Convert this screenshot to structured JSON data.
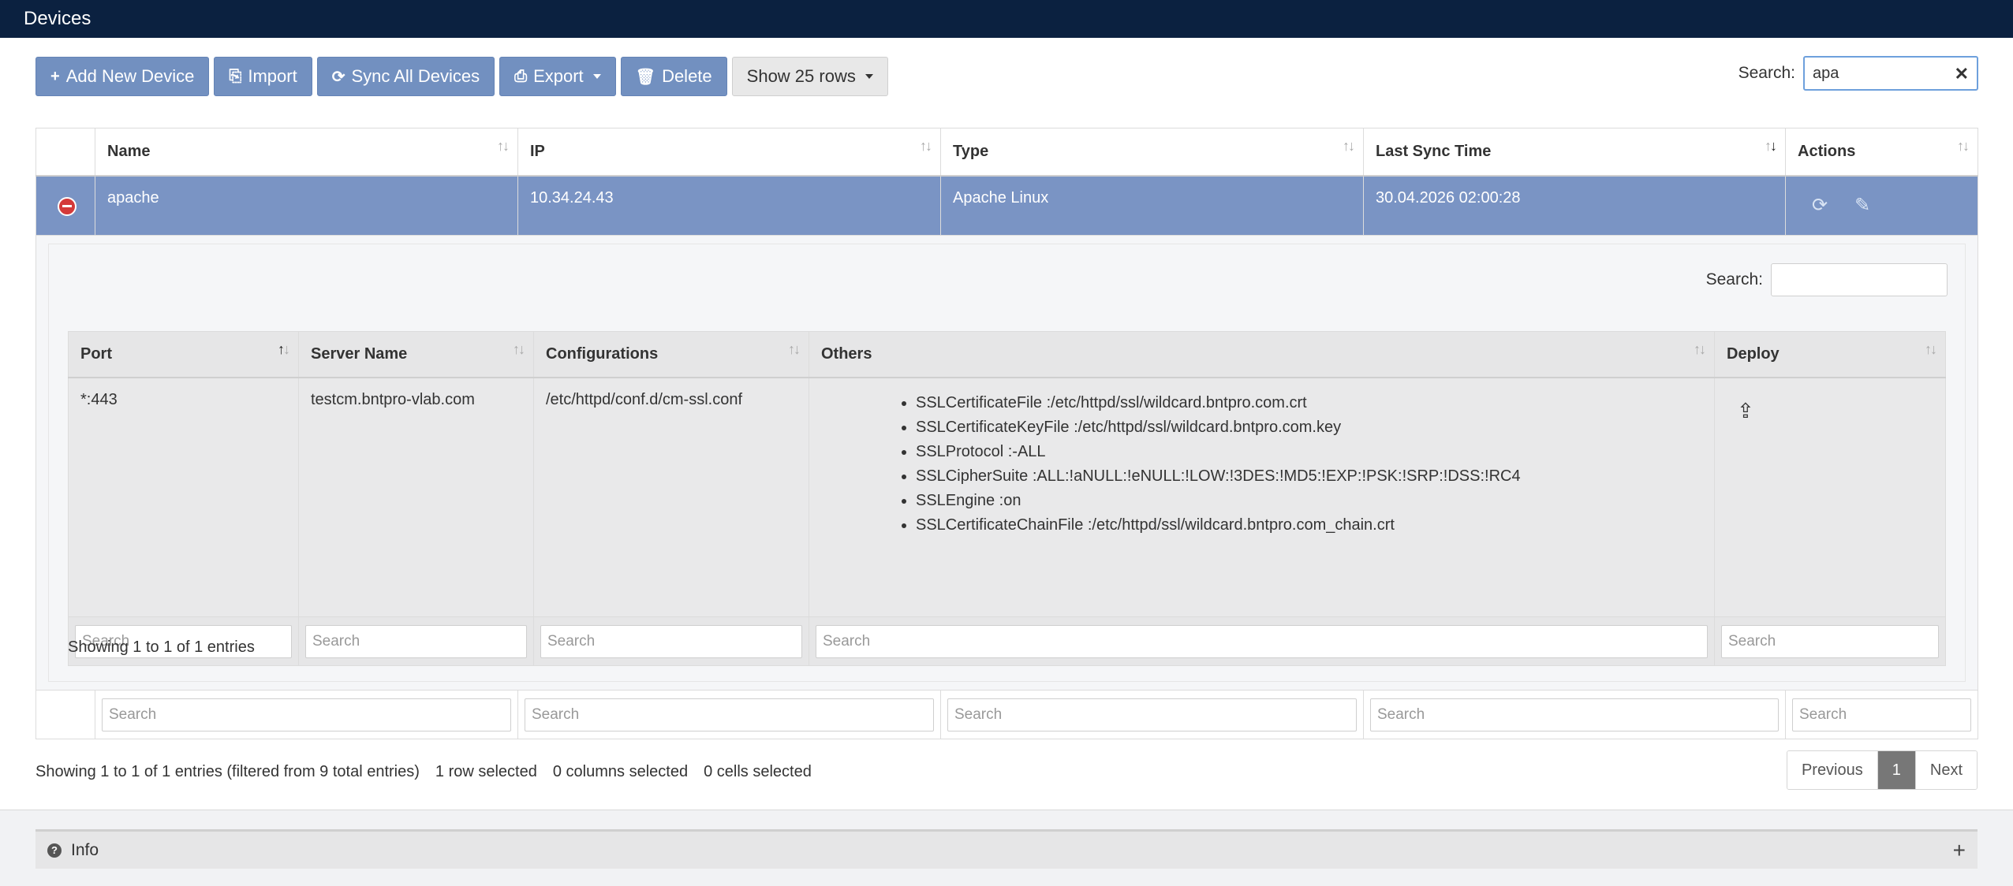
{
  "page": {
    "title": "Devices"
  },
  "toolbar": {
    "add_label": "Add New Device",
    "import_label": "Import",
    "sync_label": "Sync All Devices",
    "export_label": "Export",
    "delete_label": "Delete",
    "rows_label": "Show 25 rows"
  },
  "search": {
    "label": "Search:",
    "value": "apa"
  },
  "table": {
    "columns": [
      "Name",
      "IP",
      "Type",
      "Last Sync Time",
      "Actions"
    ],
    "rows": [
      {
        "name": "apache",
        "ip": "10.34.24.43",
        "type": "Apache Linux",
        "last_sync": "30.04.2026 02:00:28"
      }
    ],
    "filter_placeholder": "Search"
  },
  "child": {
    "search_label": "Search:",
    "columns": [
      "Port",
      "Server Name",
      "Configurations",
      "Others",
      "Deploy"
    ],
    "rows": [
      {
        "port": "*:443",
        "server_name": "testcm.bntpro-vlab.com",
        "configuration": "/etc/httpd/conf.d/cm-ssl.conf",
        "others": [
          "SSLCertificateFile :/etc/httpd/ssl/wildcard.bntpro.com.crt",
          "SSLCertificateKeyFile :/etc/httpd/ssl/wildcard.bntpro.com.key",
          "SSLProtocol :-ALL",
          "SSLCipherSuite :ALL:!aNULL:!eNULL:!LOW:!3DES:!MD5:!EXP:!PSK:!SRP:!DSS:!RC4",
          "SSLEngine :on",
          "SSLCertificateChainFile :/etc/httpd/ssl/wildcard.bntpro.com_chain.crt"
        ]
      }
    ],
    "filter_placeholder": "Search",
    "info": "Showing 1 to 1 of 1 entries"
  },
  "footer": {
    "info": "Showing 1 to 1 of 1 entries (filtered from 9 total entries)",
    "rows_selected": "1 row selected",
    "columns_selected": "0 columns selected",
    "cells_selected": "0 cells selected"
  },
  "pagination": {
    "previous": "Previous",
    "current": "1",
    "next": "Next"
  },
  "info_panel": {
    "label": "Info"
  },
  "colors": {
    "header": "#0b2140",
    "button": "#7290c0",
    "selected_row": "#7a94c4"
  }
}
